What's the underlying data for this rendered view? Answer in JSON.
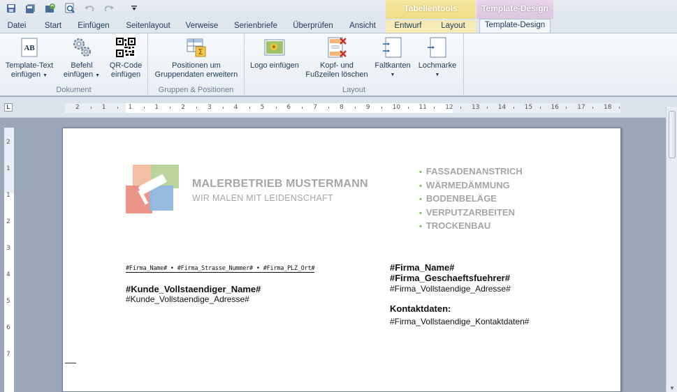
{
  "quick_access": {
    "icons": [
      "save-icon",
      "save-all-icon",
      "refresh-icon",
      "print-preview-icon",
      "undo-icon",
      "redo-icon",
      "customize-icon"
    ]
  },
  "contextual_groups": {
    "tabellentools": "Tabellentools",
    "template_design": "Template-Design"
  },
  "tabs": [
    {
      "label": "Datei"
    },
    {
      "label": "Start"
    },
    {
      "label": "Einfügen"
    },
    {
      "label": "Seitenlayout"
    },
    {
      "label": "Verweise"
    },
    {
      "label": "Serienbriefe"
    },
    {
      "label": "Überprüfen"
    },
    {
      "label": "Ansicht"
    },
    {
      "label": "Entwurf"
    },
    {
      "label": "Layout"
    },
    {
      "label": "Template-Design"
    }
  ],
  "ribbon": {
    "groups": {
      "dokument": "Dokument",
      "gruppen": "Gruppen & Positionen",
      "layout": "Layout"
    },
    "buttons": {
      "template_text_1": "Template-Text",
      "template_text_2": "einfügen",
      "befehl_1": "Befehl",
      "befehl_2": "einfügen",
      "qr_1": "QR-Code",
      "qr_2": "einfügen",
      "positionen_1": "Positionen um",
      "positionen_2": "Gruppendaten erweitern",
      "logo": "Logo einfügen",
      "kopf_1": "Kopf- und",
      "kopf_2": "Fußzeilen löschen",
      "faltkanten": "Faltkanten",
      "lochmarke": "Lochmarke"
    },
    "qr_icon_label": "AB"
  },
  "ruler": {
    "h_numbers": [
      "2",
      "1",
      "1",
      "1",
      "2",
      "3",
      "4",
      "5",
      "6",
      "7",
      "8",
      "9",
      "10",
      "11",
      "12",
      "13",
      "14",
      "15",
      "16",
      "17",
      "18"
    ],
    "v_numbers": [
      "2",
      "1",
      "1",
      "2",
      "3",
      "4",
      "5",
      "6",
      "7"
    ],
    "tab_marker": "L"
  },
  "document": {
    "company_name": "MALERBETRIEB MUSTERMANN",
    "slogan": "WIR MALEN MIT LEIDENSCHAFT",
    "services": [
      "FASSADENANSTRICH",
      "WÄRMEDÄMMUNG",
      "BODENBELÄGE",
      "VERPUTZARBEITEN",
      "TROCKENBAU"
    ],
    "sender_line": "#Firma_Name# • #Firma_Strasse_Nummer# • #Firma_PLZ_Ort#",
    "customer_name": "#Kunde_Vollstaendiger_Name#",
    "customer_address": "#Kunde_Vollstaendige_Adresse#",
    "firm_name": "#Firma_Name#",
    "firm_ceo": "#Firma_Geschaeftsfuehrer#",
    "firm_address": "#Firma_Vollstaendige_Adresse#",
    "contact_heading": "Kontaktdaten:",
    "contact_data": "#Firma_Vollstaendige_Kontaktdaten#"
  },
  "colors": {
    "accent_green": "#7cbf5a",
    "grey_text": "#a6a6a6",
    "ctx_yellow": "#f1dc88",
    "ctx_purple": "#dcc6e1"
  }
}
